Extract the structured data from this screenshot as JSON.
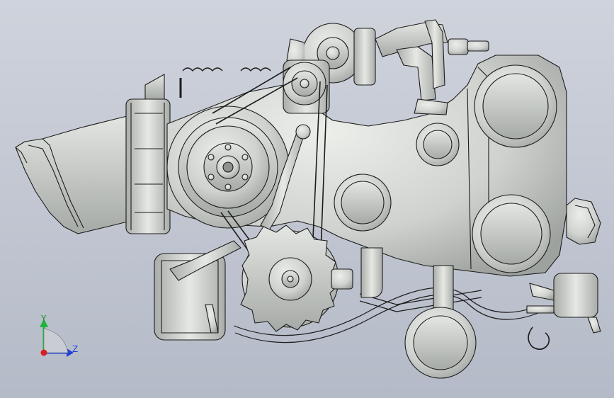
{
  "viewport": {
    "background_top": "#cfd3dc",
    "background_bottom": "#b4bac7",
    "model_fill": "#d3d6d3",
    "model_shade": "#a9ada9",
    "edge_color": "#1c1c1c"
  },
  "triad": {
    "y_label": "Y",
    "z_label": "Z",
    "y_color": "#1fb53c",
    "z_color": "#1f3fd8",
    "x_color": "#d81f1f"
  }
}
